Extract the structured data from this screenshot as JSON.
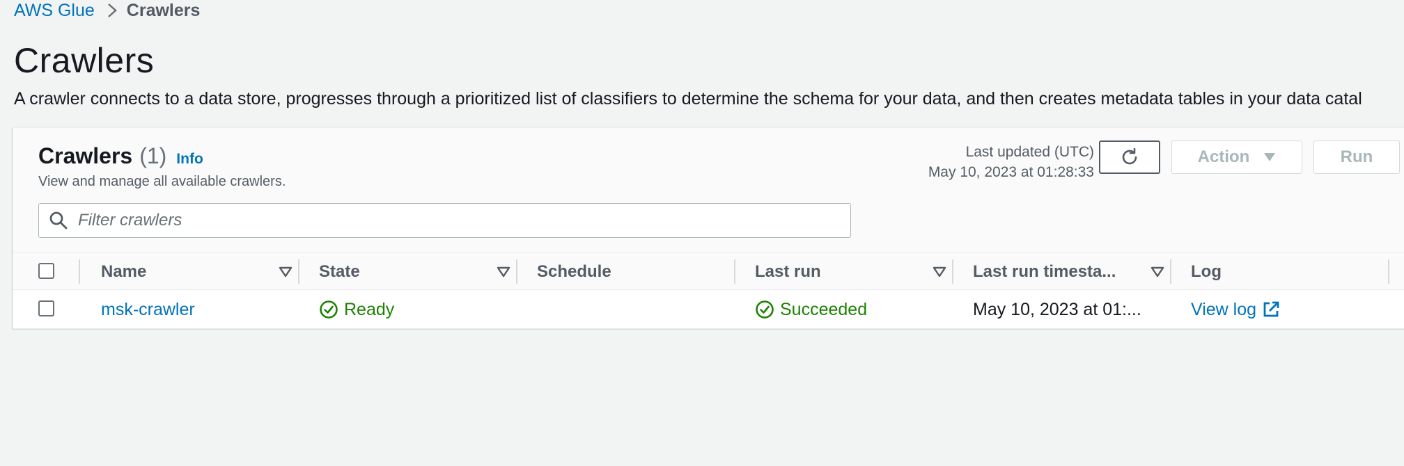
{
  "breadcrumb": {
    "service": "AWS Glue",
    "current": "Crawlers"
  },
  "page": {
    "title": "Crawlers",
    "description": "A crawler connects to a data store, progresses through a prioritized list of classifiers to determine the schema for your data, and then creates metadata tables in your data catal"
  },
  "panel": {
    "title": "Crawlers",
    "count": "(1)",
    "info": "Info",
    "subtitle": "View and manage all available crawlers.",
    "last_updated_label": "Last updated (UTC)",
    "last_updated_value": "May 10, 2023 at 01:28:33",
    "action_label": "Action",
    "run_label": "Run"
  },
  "search": {
    "placeholder": "Filter crawlers"
  },
  "table": {
    "columns": {
      "name": "Name",
      "state": "State",
      "schedule": "Schedule",
      "last_run": "Last run",
      "last_run_timestamp": "Last run timesta...",
      "log": "Log"
    },
    "rows": [
      {
        "name": "msk-crawler",
        "state": "Ready",
        "schedule": "",
        "last_run": "Succeeded",
        "last_run_timestamp": "May 10, 2023 at 01:...",
        "log": "View log"
      }
    ]
  },
  "colors": {
    "link": "#0073bb",
    "success": "#1d8102",
    "background": "#f2f3f3"
  },
  "icons": {
    "breadcrumb_separator": "chevron-right-icon",
    "refresh": "refresh-icon",
    "action_caret": "caret-down-icon",
    "search": "search-icon",
    "sort": "sort-caret-icon",
    "status": "check-circle-icon",
    "external": "external-link-icon"
  }
}
